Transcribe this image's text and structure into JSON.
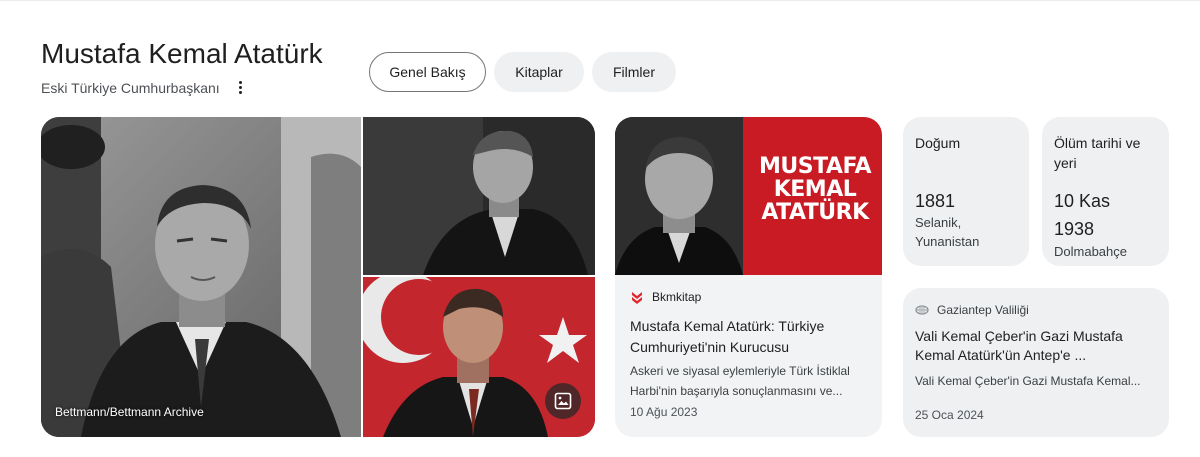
{
  "header": {
    "title": "Mustafa Kemal Atatürk",
    "subtitle": "Eski Türkiye Cumhurbaşkanı",
    "more_icon": "more-vert-icon"
  },
  "tabs": [
    {
      "label": "Genel Bakış",
      "active": true
    },
    {
      "label": "Kitaplar",
      "active": false
    },
    {
      "label": "Filmler",
      "active": false
    }
  ],
  "images": {
    "main_caption": "Bettmann/Bettmann Archive",
    "more_images_icon": "image-icon"
  },
  "article": {
    "thumb_brand": "MUSTAFA KEMAL ATATÜRK",
    "source": "Bkmkitap",
    "source_icon": "bkm-logo-icon",
    "title": "Mustafa Kemal Atatürk: Türkiye Cumhuriyeti'nin Kurucusu",
    "snippet": "Askeri ve siyasal eylemleriyle Türk İstiklal Harbi'nin başarıyla sonuçlanmasını ve...",
    "date": "10 Ağu 2023"
  },
  "facts": [
    {
      "label": "Doğum",
      "value": "1881",
      "sub": "Selanik, Yunanistan"
    },
    {
      "label": "Ölüm tarihi ve yeri",
      "value": "10 Kas 1938",
      "sub": "Dolmabahçe"
    }
  ],
  "news": {
    "source": "Gaziantep Valiliği",
    "source_icon": "site-icon",
    "title": "Vali Kemal Çeber'in Gazi Mustafa Kemal Atatürk'ün Antep'e ...",
    "snippet": "Vali Kemal Çeber'in Gazi Mustafa Kemal...",
    "date": "25 Oca 2024"
  },
  "colors": {
    "chip_bg": "#eef0f2",
    "card_bg": "#eef0f2",
    "brand_red": "#c91b23"
  }
}
